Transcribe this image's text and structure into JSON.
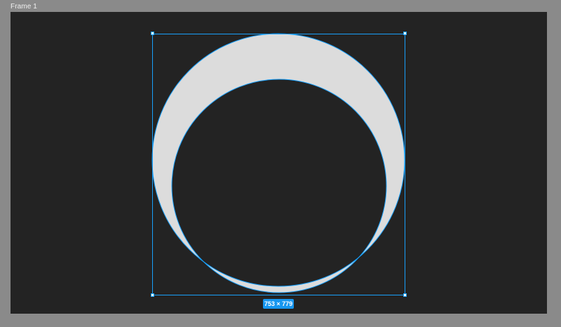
{
  "frame": {
    "label": "Frame 1"
  },
  "selection": {
    "size_label": "753 × 779"
  },
  "colors": {
    "workspace": "#8a8a8a",
    "frame_background": "#232323",
    "crescent_fill": "#dcdcdc",
    "selection_accent": "#18a0fb",
    "badge_background": "#1696f0"
  }
}
